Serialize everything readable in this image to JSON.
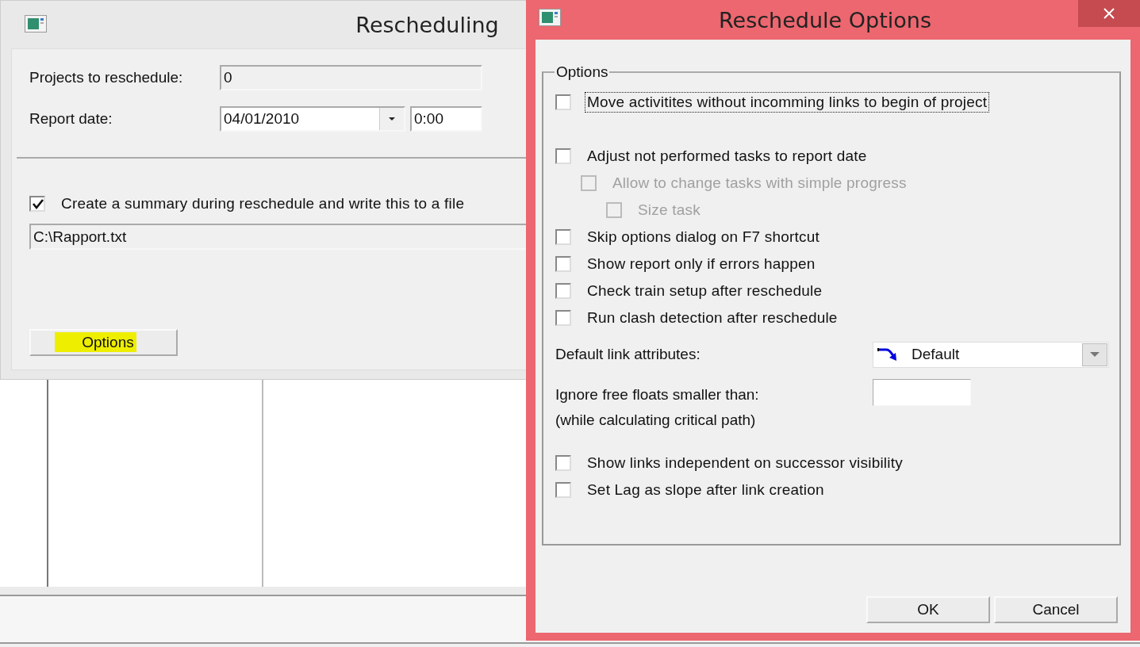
{
  "rescheduling": {
    "title": "Rescheduling",
    "projects_label": "Projects to reschedule:",
    "projects_value": "0",
    "report_date_label": "Report date:",
    "report_date": "04/01/2010",
    "report_time": "0:00",
    "summary": {
      "label": "Create a summary during reschedule and write this to a file",
      "checked": true
    },
    "file_path": "C:\\Rapport.txt",
    "options_button": {
      "label": "Options",
      "highlighted": true
    }
  },
  "reschedule_options": {
    "title": "Reschedule Options",
    "group_label": "Options",
    "options_top": [
      {
        "label": "Move activitites without incomming links to begin of project",
        "checked": false,
        "disabled": false,
        "focused": true
      },
      {
        "label": "Adjust not performed tasks to report date",
        "checked": false,
        "disabled": false,
        "focused": false,
        "children": [
          {
            "label": "Allow to change tasks with simple progress",
            "checked": false,
            "disabled": true,
            "focused": false,
            "children": [
              {
                "label": "Size task",
                "checked": false,
                "disabled": true,
                "focused": false
              }
            ]
          }
        ]
      },
      {
        "label": "Skip options dialog on F7 shortcut",
        "checked": false,
        "disabled": false,
        "focused": false
      },
      {
        "label": "Show report only if errors happen",
        "checked": false,
        "disabled": false,
        "focused": false
      },
      {
        "label": "Check train setup after reschedule",
        "checked": false,
        "disabled": false,
        "focused": false
      },
      {
        "label": "Run clash detection after reschedule",
        "checked": false,
        "disabled": false,
        "focused": false
      }
    ],
    "link_attributes": {
      "label": "Default link attributes:",
      "value": "Default"
    },
    "free_floats": {
      "label": "Ignore free floats smaller than:",
      "note": "(while calculating critical path)"
    },
    "options_bottom": [
      {
        "label": "Show links independent on successor visibility",
        "checked": false,
        "disabled": false,
        "focused": false
      },
      {
        "label": "Set Lag as slope after link creation",
        "checked": false,
        "disabled": false,
        "focused": false
      }
    ],
    "buttons": [
      {
        "label": "OK"
      },
      {
        "label": "Cancel"
      }
    ]
  }
}
